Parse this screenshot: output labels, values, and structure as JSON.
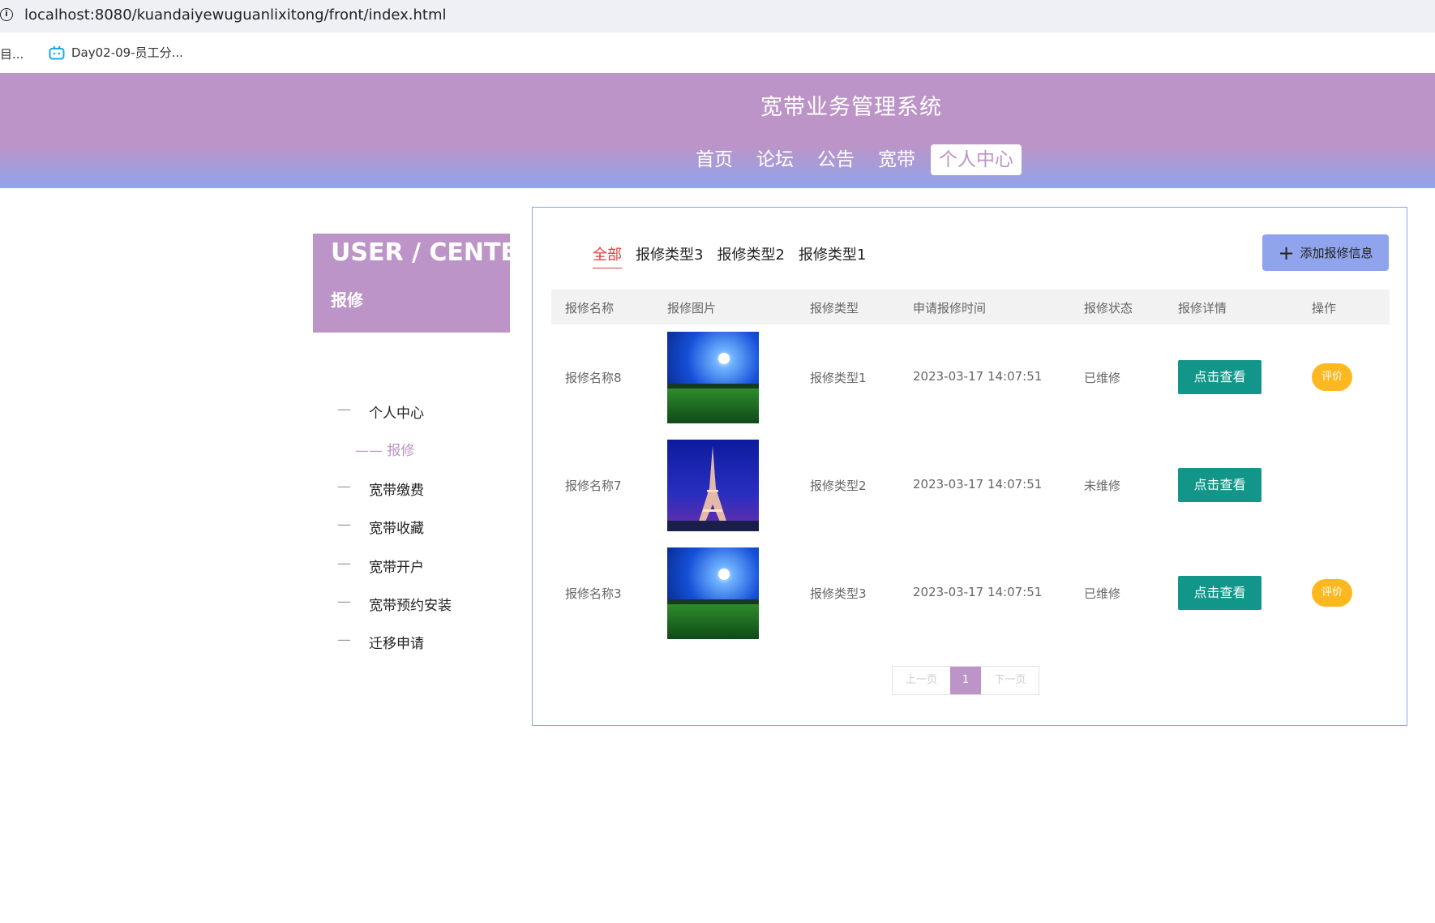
{
  "browser": {
    "url": "localhost:8080/kuandaiyewuguanlixitong/front/index.html",
    "bookmark_left": "目...",
    "bookmark_item": "Day02-09-员工分..."
  },
  "header": {
    "site_title": "宽带业务管理系统",
    "nav": [
      "首页",
      "论坛",
      "公告",
      "宽带",
      "个人中心"
    ],
    "active_nav": "个人中心",
    "brand_color": "#bd94c7",
    "gradient_color": "#8fa4ec"
  },
  "user_center": {
    "title": "USER / CENTER",
    "subtitle": "报修",
    "menu": [
      "个人中心",
      "宽带缴费",
      "宽带收藏",
      "宽带开户",
      "宽带预约安装",
      "迁移申请"
    ],
    "active_sub": "—— 报修",
    "dash": "—"
  },
  "repair": {
    "tabs": [
      "全部",
      "报修类型3",
      "报修类型2",
      "报修类型1"
    ],
    "active_tab": "全部",
    "add_button": "添加报修信息",
    "columns": [
      "报修名称",
      "报修图片",
      "报修类型",
      "申请报修时间",
      "报修状态",
      "报修详情",
      "操作"
    ],
    "rows": [
      {
        "name": "报修名称8",
        "image": "night-field-moon",
        "type": "报修类型1",
        "time": "2023-03-17 14:07:51",
        "status": "已维修",
        "detail": "点击查看",
        "action": "评价"
      },
      {
        "name": "报修名称7",
        "image": "eiffel-tower-night",
        "type": "报修类型2",
        "time": "2023-03-17 14:07:51",
        "status": "未维修",
        "detail": "点击查看",
        "action": ""
      },
      {
        "name": "报修名称3",
        "image": "night-field-moon",
        "type": "报修类型3",
        "time": "2023-03-17 14:07:51",
        "status": "已维修",
        "detail": "点击查看",
        "action": "评价"
      }
    ]
  },
  "pagination": {
    "prev": "上一页",
    "current": "1",
    "next": "下一页"
  }
}
